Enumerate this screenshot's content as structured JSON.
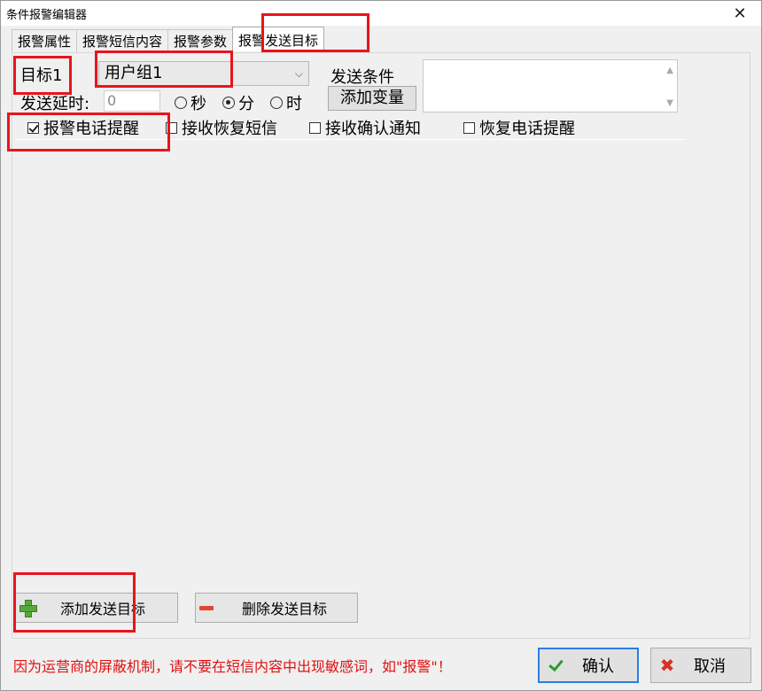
{
  "window": {
    "title": "条件报警编辑器"
  },
  "tabs": [
    {
      "label": "报警属性"
    },
    {
      "label": "报警短信内容"
    },
    {
      "label": "报警参数"
    },
    {
      "label": "报警发送目标"
    }
  ],
  "target": {
    "label": "目标1",
    "combo_value": "用户组1",
    "delay_label": "发送延时:",
    "delay_value": "0",
    "units": [
      "秒",
      "分",
      "时"
    ],
    "selected_unit": "分",
    "condition_label": "发送条件",
    "add_variable": "添加变量",
    "options": [
      {
        "label": "报警电话提醒",
        "checked": true
      },
      {
        "label": "接收恢复短信",
        "checked": false
      },
      {
        "label": "接收确认通知",
        "checked": false
      },
      {
        "label": "恢复电话提醒",
        "checked": false
      }
    ]
  },
  "actions": {
    "add_target": "添加发送目标",
    "delete_target": "删除发送目标"
  },
  "footer": {
    "warning": "因为运营商的屏蔽机制，请不要在短信内容中出现敏感词，如\"报警\"！",
    "ok": "确认",
    "cancel": "取消"
  },
  "colors": {
    "highlight": "#e8141c",
    "warning": "#e01010"
  }
}
